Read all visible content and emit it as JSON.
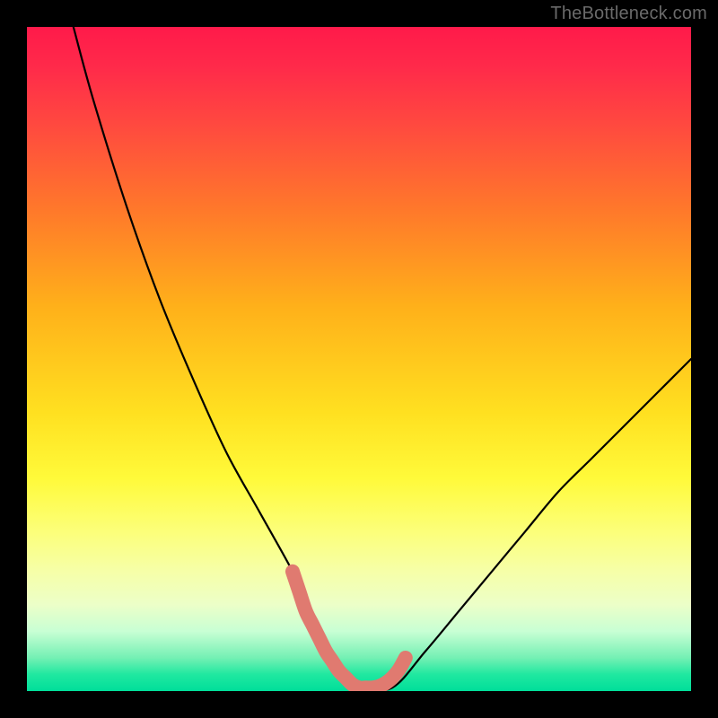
{
  "watermark": "TheBottleneck.com",
  "colors": {
    "background_frame": "#000000",
    "gradient_top": "#ff1a4a",
    "gradient_mid": "#ffe020",
    "gradient_bottom": "#00de9a",
    "curve": "#000000",
    "marker": "#e07a70"
  },
  "chart_data": {
    "type": "line",
    "title": "",
    "xlabel": "",
    "ylabel": "",
    "xlim": [
      0,
      100
    ],
    "ylim": [
      0,
      100
    ],
    "series": [
      {
        "name": "bottleneck-curve",
        "x": [
          7,
          10,
          15,
          20,
          25,
          30,
          35,
          40,
          41,
          43,
          45,
          47,
          49,
          50,
          55,
          60,
          65,
          70,
          75,
          80,
          85,
          90,
          95,
          100
        ],
        "values": [
          100,
          89,
          73,
          59,
          47,
          36,
          27,
          18,
          15,
          10,
          6,
          3,
          1,
          0.5,
          0.5,
          6,
          12,
          18,
          24,
          30,
          35,
          40,
          45,
          50
        ]
      }
    ],
    "markers": [
      {
        "name": "valley-marker",
        "x": [
          40,
          41,
          42,
          43,
          44,
          45,
          46,
          47,
          48,
          49,
          50,
          51,
          52,
          53,
          54,
          55,
          56,
          57
        ],
        "values": [
          18,
          15,
          12,
          10,
          8,
          6,
          4.5,
          3,
          2,
          1,
          0.5,
          0.5,
          0.5,
          0.7,
          1.2,
          2,
          3.2,
          5
        ]
      }
    ],
    "legend": []
  }
}
